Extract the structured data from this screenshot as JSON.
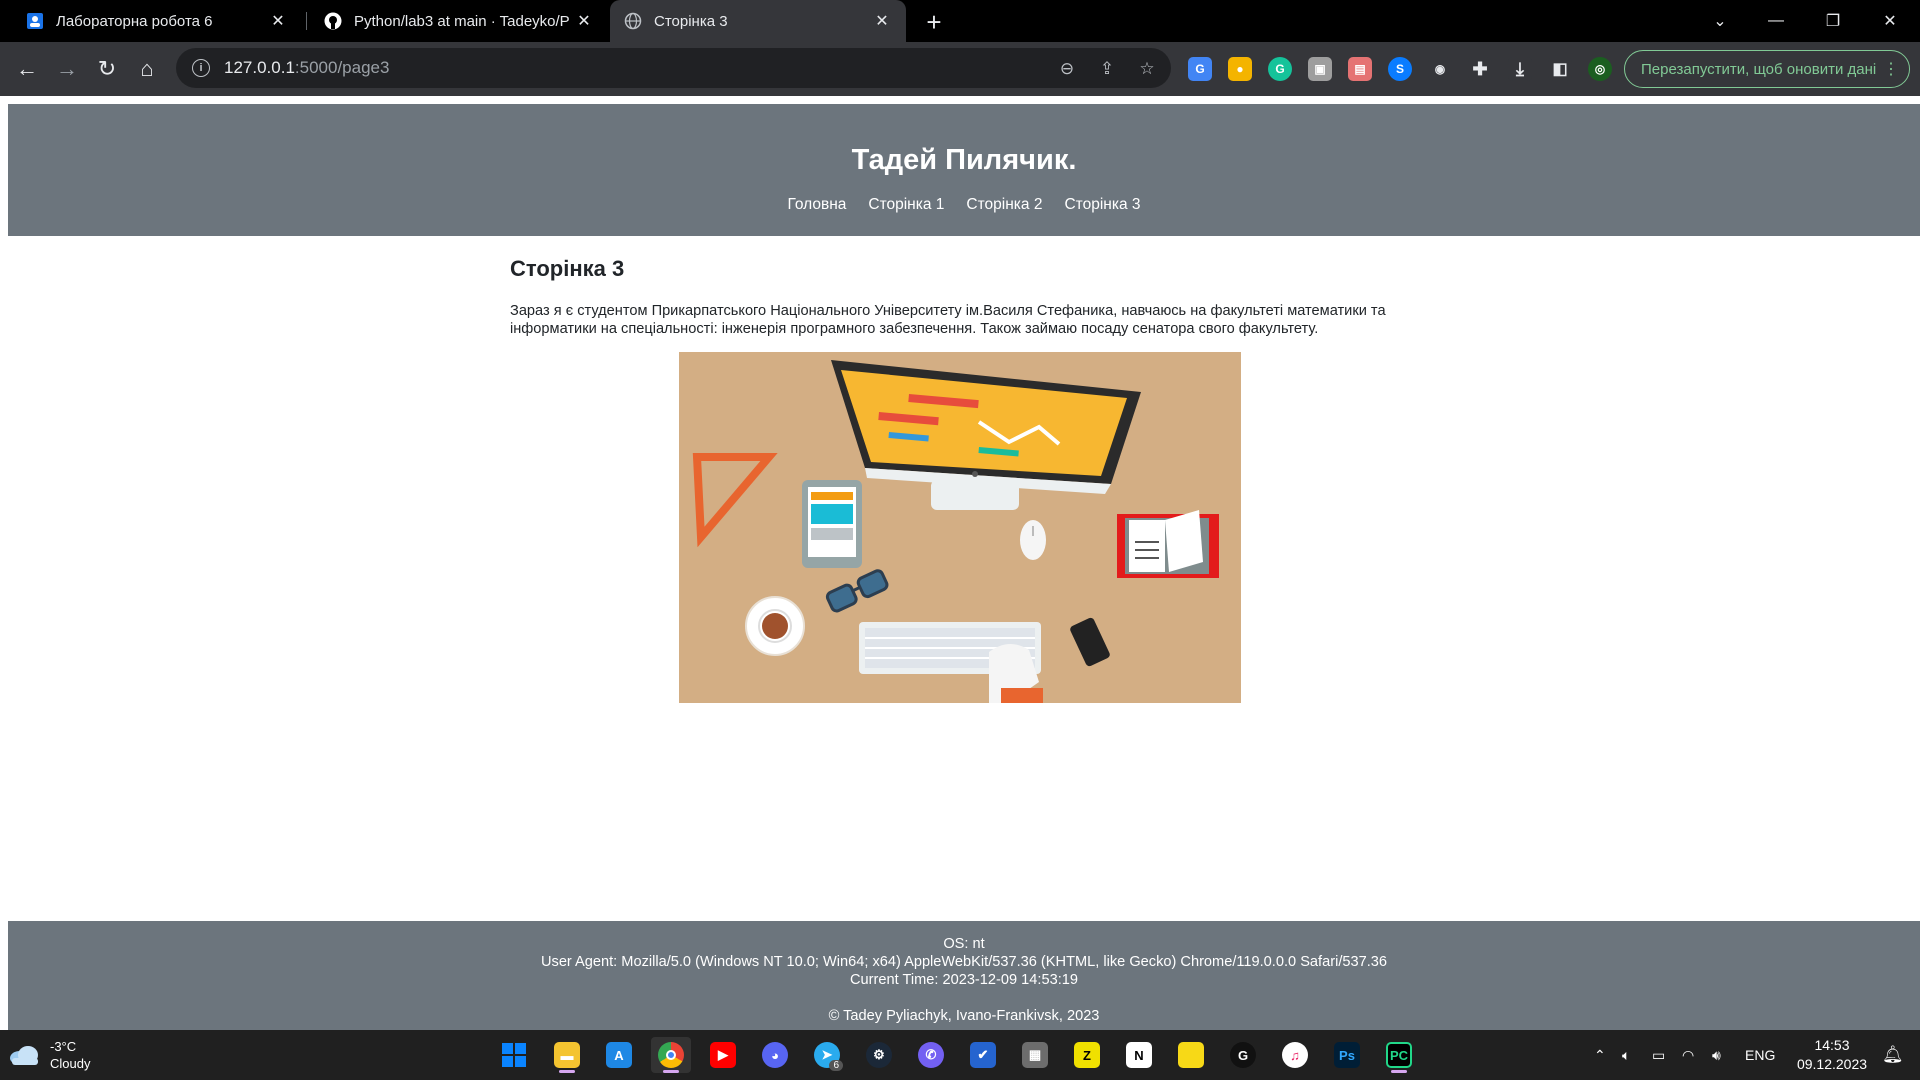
{
  "browser": {
    "tabs": [
      {
        "title": "Лабораторна робота 6",
        "icon": "google-classroom-icon"
      },
      {
        "title": "Python/lab3 at main · Tadeyko/P",
        "icon": "github-icon"
      },
      {
        "title": "Сторінка 3",
        "icon": "globe-icon",
        "active": true
      }
    ],
    "url_host": "127.0.0.1",
    "url_rest": ":5000/page3",
    "relaunch_label": "Перезапустити, щоб оновити дані"
  },
  "site": {
    "title": "Тадей Пилячик.",
    "nav": [
      "Головна",
      "Сторінка 1",
      "Сторінка 2",
      "Сторінка 3"
    ],
    "page_title": "Сторінка 3",
    "page_text": "Зараз я є студентом Прикарпатського Національного Університету ім.Василя Стефаника, навчаюсь на факультеті математики та інформатики на спеціальності: інженерія програмного забезпечення. Також займаю посаду сенатора свого факультету.",
    "footer": {
      "os": "OS: nt",
      "user_agent": "User Agent: Mozilla/5.0 (Windows NT 10.0; Win64; x64) AppleWebKit/537.36 (KHTML, like Gecko) Chrome/119.0.0.0 Safari/537.36",
      "time": "Current Time: 2023-12-09 14:53:19",
      "copyright": "© Tadey Pyliachyk, Ivano-Frankivsk, 2023"
    },
    "colors": {
      "header_bg": "#6c757d",
      "illustration_bg": "#d3ae84"
    }
  },
  "taskbar": {
    "weather_temp": "-3°C",
    "weather_desc": "Cloudy",
    "language": "ENG",
    "time": "14:53",
    "date": "09.12.2023",
    "telegram_badge": "6"
  }
}
